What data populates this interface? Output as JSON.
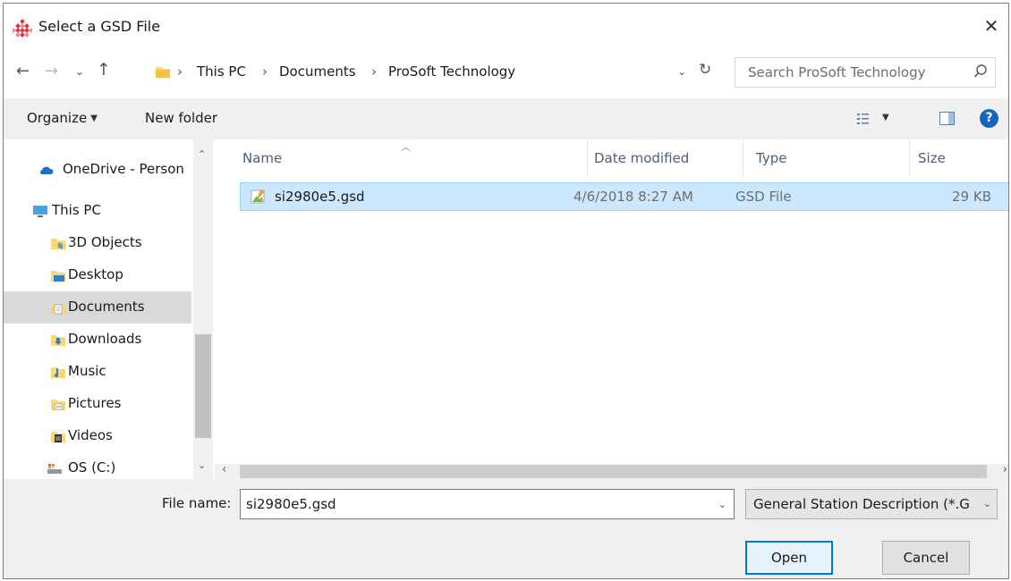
{
  "window": {
    "title": "Select a GSD File"
  },
  "nav": {
    "breadcrumb": [
      "This PC",
      "Documents",
      "ProSoft Technology"
    ],
    "search_placeholder": "Search ProSoft Technology"
  },
  "toolbar": {
    "organize_label": "Organize",
    "new_folder_label": "New folder",
    "help": "?"
  },
  "sidebar": {
    "items": [
      {
        "label": "OneDrive - Person",
        "icon": "cloud-icon"
      },
      {
        "label": "This PC",
        "icon": "computer-icon"
      },
      {
        "label": "3D Objects",
        "icon": "3d-objects-icon"
      },
      {
        "label": "Desktop",
        "icon": "desktop-icon"
      },
      {
        "label": "Documents",
        "icon": "documents-icon",
        "selected": true
      },
      {
        "label": "Downloads",
        "icon": "downloads-icon"
      },
      {
        "label": "Music",
        "icon": "music-icon"
      },
      {
        "label": "Pictures",
        "icon": "pictures-icon"
      },
      {
        "label": "Videos",
        "icon": "videos-icon"
      },
      {
        "label": "OS (C:)",
        "icon": "drive-icon"
      }
    ]
  },
  "columns": {
    "name": "Name",
    "date": "Date modified",
    "type": "Type",
    "size": "Size"
  },
  "files": [
    {
      "name": "si2980e5.gsd",
      "date": "4/6/2018 8:27 AM",
      "type": "GSD File",
      "size": "29 KB",
      "selected": true
    }
  ],
  "footer": {
    "filename_label": "File name:",
    "filename_value": "si2980e5.gsd",
    "filetype_value": "General Station Description (*.G",
    "open_label": "Open",
    "cancel_label": "Cancel"
  },
  "colors": {
    "accent": "#0078d7",
    "selection": "#cce8ff",
    "selection_border": "#99d1ff",
    "help": "#1565c0"
  }
}
